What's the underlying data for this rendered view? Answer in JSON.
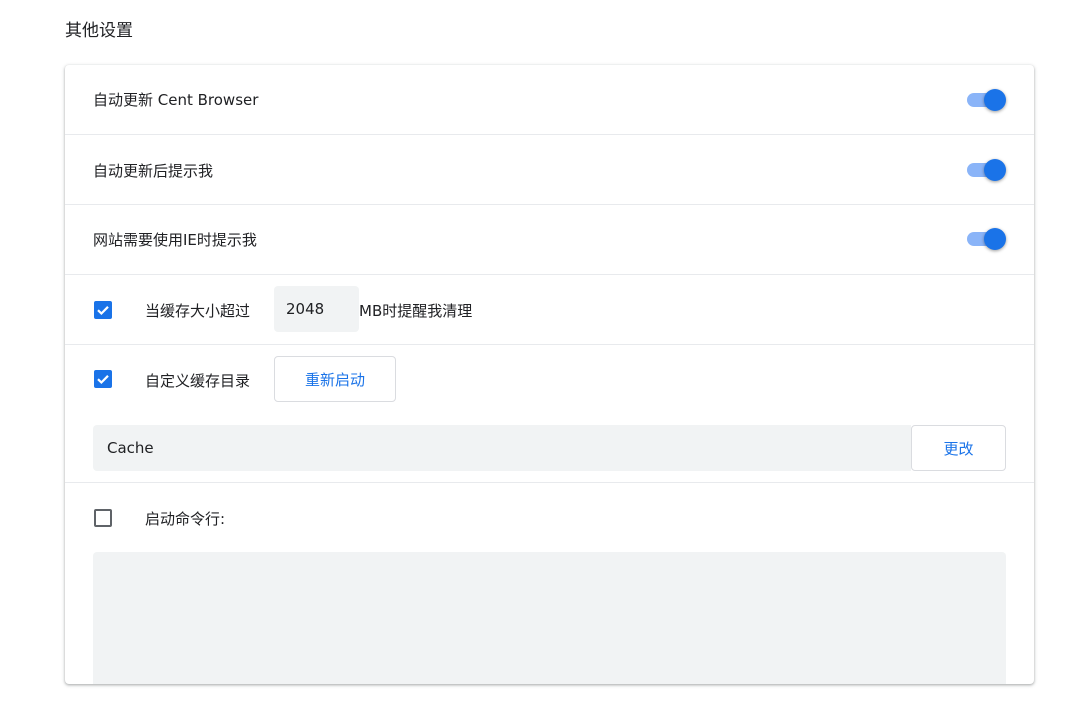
{
  "section": {
    "title": "其他设置"
  },
  "settings": {
    "auto_update": {
      "label": "自动更新 Cent Browser",
      "enabled": true
    },
    "notify_after_update": {
      "label": "自动更新后提示我",
      "enabled": true
    },
    "ie_prompt": {
      "label": "网站需要使用IE时提示我",
      "enabled": true
    }
  },
  "cache_limit": {
    "checked": true,
    "label_before": "当缓存大小超过",
    "value": "2048",
    "label_after": "MB时提醒我清理"
  },
  "custom_cache_dir": {
    "checked": true,
    "label": "自定义缓存目录",
    "restart_button": "重新启动",
    "path_value": "Cache",
    "change_button": "更改"
  },
  "startup_cmdline": {
    "checked": false,
    "label": "启动命令行:",
    "value": ""
  },
  "colors": {
    "accent": "#1a73e8",
    "toggle_track": "#8ab4f8",
    "field_bg": "#f1f3f4"
  }
}
